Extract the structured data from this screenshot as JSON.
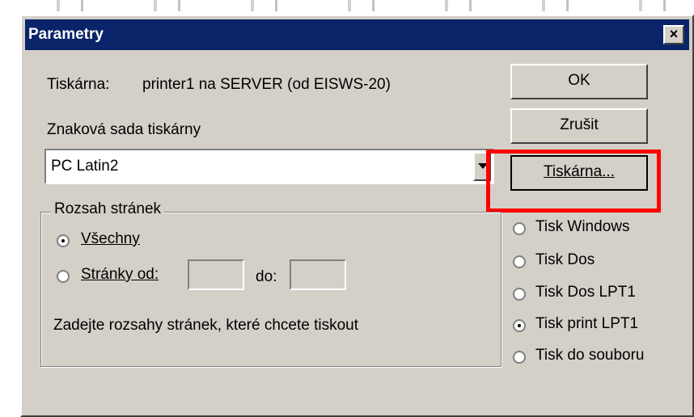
{
  "dialog": {
    "title": "Parametry",
    "close_label": "×"
  },
  "printer": {
    "label": "Tiskárna:",
    "value": "printer1 na SERVER (od EISWS-20)"
  },
  "charset": {
    "label": "Znaková sada tiskárny",
    "selected": "PC Latin2"
  },
  "buttons": {
    "ok": "OK",
    "cancel": "Zrušit",
    "printer": "Tiskárna..."
  },
  "page_range": {
    "legend": "Rozsah stránek",
    "all": "Všechny",
    "pages_from": "Stránky od:",
    "to": "do:",
    "hint": "Zadejte rozsahy stránek, které chcete tiskout",
    "selected": "all"
  },
  "print_mode": {
    "options": [
      "Tisk Windows",
      "Tisk Dos",
      "Tisk Dos LPT1",
      "Tisk print LPT1",
      "Tisk do souboru"
    ],
    "selected_index": 3
  },
  "highlight_color": "#ff0000"
}
